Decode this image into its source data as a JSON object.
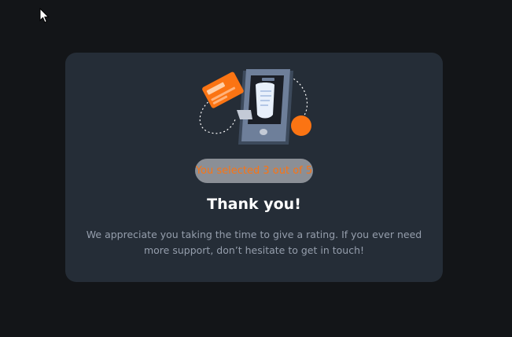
{
  "cursor": {
    "icon": "arrow-cursor-icon"
  },
  "card": {
    "illustration": {
      "icon": "phone-payment-illustration"
    },
    "selection_badge": "You selected 3 out of 5",
    "title": "Thank you!",
    "message": "We appreciate you taking the time to give a rating. If you ever need more support, don’t hesitate to get in touch!"
  },
  "colors": {
    "page_background": "#131518",
    "card_background": "#252d37",
    "accent": "#fb7413",
    "badge_background": "#8b8f96",
    "muted_text": "#959eac"
  }
}
